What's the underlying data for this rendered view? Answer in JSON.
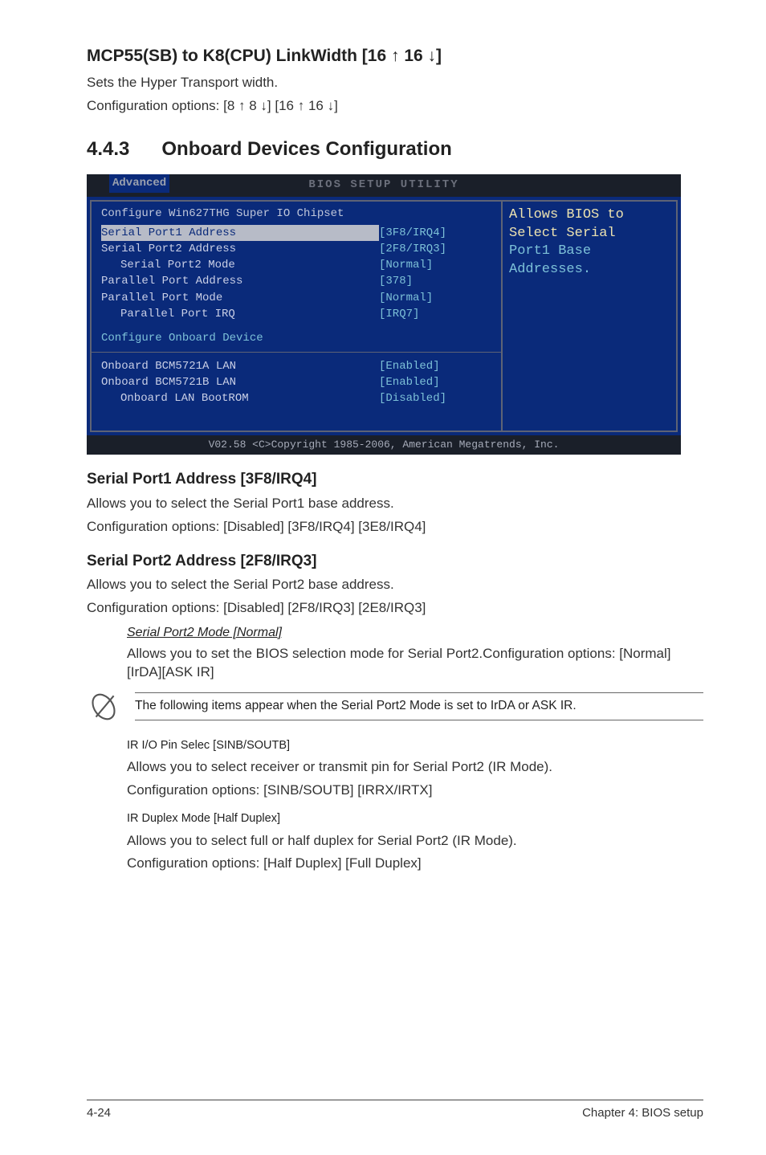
{
  "sec_mcp": {
    "title_a": "MCP55(SB) to K8(CPU) LinkWidth [16 ",
    "title_b": " 16 ",
    "title_c": "]",
    "line1": "Sets the Hyper Transport width.",
    "line2_a": "Configuration options: [8 ",
    "line2_b": " 8 ",
    "line2_c": "] [16 ",
    "line2_d": " 16 ",
    "line2_e": "]"
  },
  "sec443": {
    "num": "4.4.3",
    "title": "Onboard Devices Configuration"
  },
  "bios": {
    "title": "BIOS SETUP UTILITY",
    "tab": "Advanced",
    "heading": "Configure Win627THG Super IO Chipset",
    "rows": [
      {
        "label": "Serial Port1 Address",
        "value": "[3F8/IRQ4]",
        "hl": true
      },
      {
        "label": "Serial Port2 Address",
        "value": "[2F8/IRQ3]"
      },
      {
        "label": "Serial Port2 Mode",
        "value": "[Normal]",
        "indent": true
      },
      {
        "label": "Parallel Port Address",
        "value": "[378]"
      },
      {
        "label": "Parallel Port Mode",
        "value": "[Normal]"
      },
      {
        "label": "Parallel Port IRQ",
        "value": "[IRQ7]",
        "indent": true
      }
    ],
    "link": "Configure Onboard Device",
    "rows2": [
      {
        "label": "Onboard BCM5721A LAN",
        "value": "[Enabled]"
      },
      {
        "label": "Onboard BCM5721B LAN",
        "value": "[Enabled]"
      },
      {
        "label": "Onboard LAN BootROM",
        "value": "[Disabled]",
        "indent": true
      }
    ],
    "help1": "Allows BIOS to",
    "help2": "Select Serial",
    "help3": "Port1 Base",
    "help4": "Addresses.",
    "foot": "V02.58 <C>Copyright 1985-2006, American Megatrends, Inc."
  },
  "serial1": {
    "h": "Serial Port1 Address [3F8/IRQ4]",
    "p1": "Allows you to select the Serial Port1 base address.",
    "p2": "Configuration options: [Disabled] [3F8/IRQ4] [3E8/IRQ4]"
  },
  "serial2": {
    "h": "Serial Port2 Address [2F8/IRQ3]",
    "p1": "Allows you to select the Serial Port2 base address.",
    "p2": "Configuration options: [Disabled] [2F8/IRQ3] [2E8/IRQ3]"
  },
  "sp2mode": {
    "h": "Serial Port2 Mode [Normal]",
    "p": "Allows you to set the BIOS selection mode for Serial Port2.Configuration options: [Normal] [IrDA][ASK IR]"
  },
  "note": "The following items appear when the Serial Port2 Mode is set to IrDA or ASK IR.",
  "irio": {
    "h": "IR I/O Pin Selec [SINB/SOUTB]",
    "p1": "Allows you to select receiver or transmit pin for Serial Port2 (IR Mode).",
    "p2": "Configuration options: [SINB/SOUTB] [IRRX/IRTX]"
  },
  "irdup": {
    "h": "IR Duplex Mode [Half Duplex]",
    "p1": "Allows you to select full or half duplex for Serial Port2 (IR Mode).",
    "p2": "Configuration options: [Half Duplex] [Full Duplex]"
  },
  "footer": {
    "left": "4-24",
    "right": "Chapter 4: BIOS setup"
  },
  "arrows": {
    "up": "↑",
    "down": "↓"
  }
}
